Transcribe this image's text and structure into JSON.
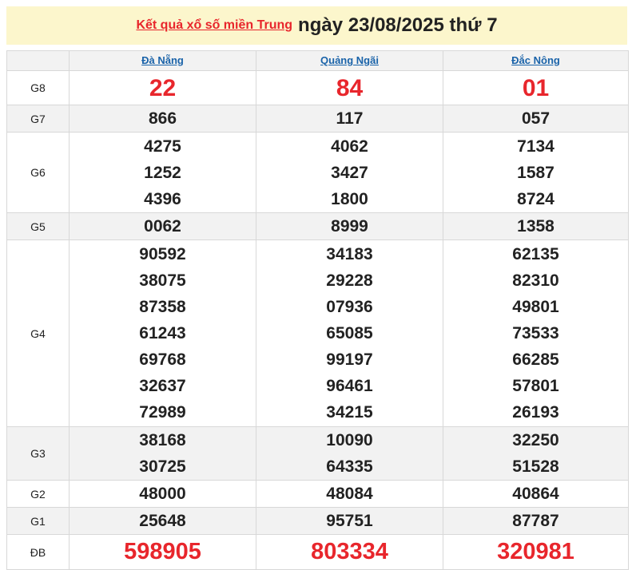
{
  "header": {
    "link_text": "Kết quả xổ số miền Trung",
    "date_text": "ngày 23/08/2025 thứ 7"
  },
  "provinces": [
    "Đà Nẵng",
    "Quảng Ngãi",
    "Đắc Nông"
  ],
  "prizes": [
    {
      "label": "G8",
      "values": [
        [
          "22"
        ],
        [
          "84"
        ],
        [
          "01"
        ]
      ]
    },
    {
      "label": "G7",
      "values": [
        [
          "866"
        ],
        [
          "117"
        ],
        [
          "057"
        ]
      ]
    },
    {
      "label": "G6",
      "values": [
        [
          "4275",
          "1252",
          "4396"
        ],
        [
          "4062",
          "3427",
          "1800"
        ],
        [
          "7134",
          "1587",
          "8724"
        ]
      ]
    },
    {
      "label": "G5",
      "values": [
        [
          "0062"
        ],
        [
          "8999"
        ],
        [
          "1358"
        ]
      ]
    },
    {
      "label": "G4",
      "values": [
        [
          "90592",
          "38075",
          "87358",
          "61243",
          "69768",
          "32637",
          "72989"
        ],
        [
          "34183",
          "29228",
          "07936",
          "65085",
          "99197",
          "96461",
          "34215"
        ],
        [
          "62135",
          "82310",
          "49801",
          "73533",
          "66285",
          "57801",
          "26193"
        ]
      ]
    },
    {
      "label": "G3",
      "values": [
        [
          "38168",
          "30725"
        ],
        [
          "10090",
          "64335"
        ],
        [
          "32250",
          "51528"
        ]
      ]
    },
    {
      "label": "G2",
      "values": [
        [
          "48000"
        ],
        [
          "48084"
        ],
        [
          "40864"
        ]
      ]
    },
    {
      "label": "G1",
      "values": [
        [
          "25648"
        ],
        [
          "95751"
        ],
        [
          "87787"
        ]
      ]
    },
    {
      "label": "ĐB",
      "values": [
        [
          "598905"
        ],
        [
          "803334"
        ],
        [
          "320981"
        ]
      ]
    }
  ],
  "colors": {
    "highlight": "#e8262c",
    "header_bg": "#fcf6cc",
    "link": "#1a63a9",
    "alt_row": "#f2f2f2"
  }
}
